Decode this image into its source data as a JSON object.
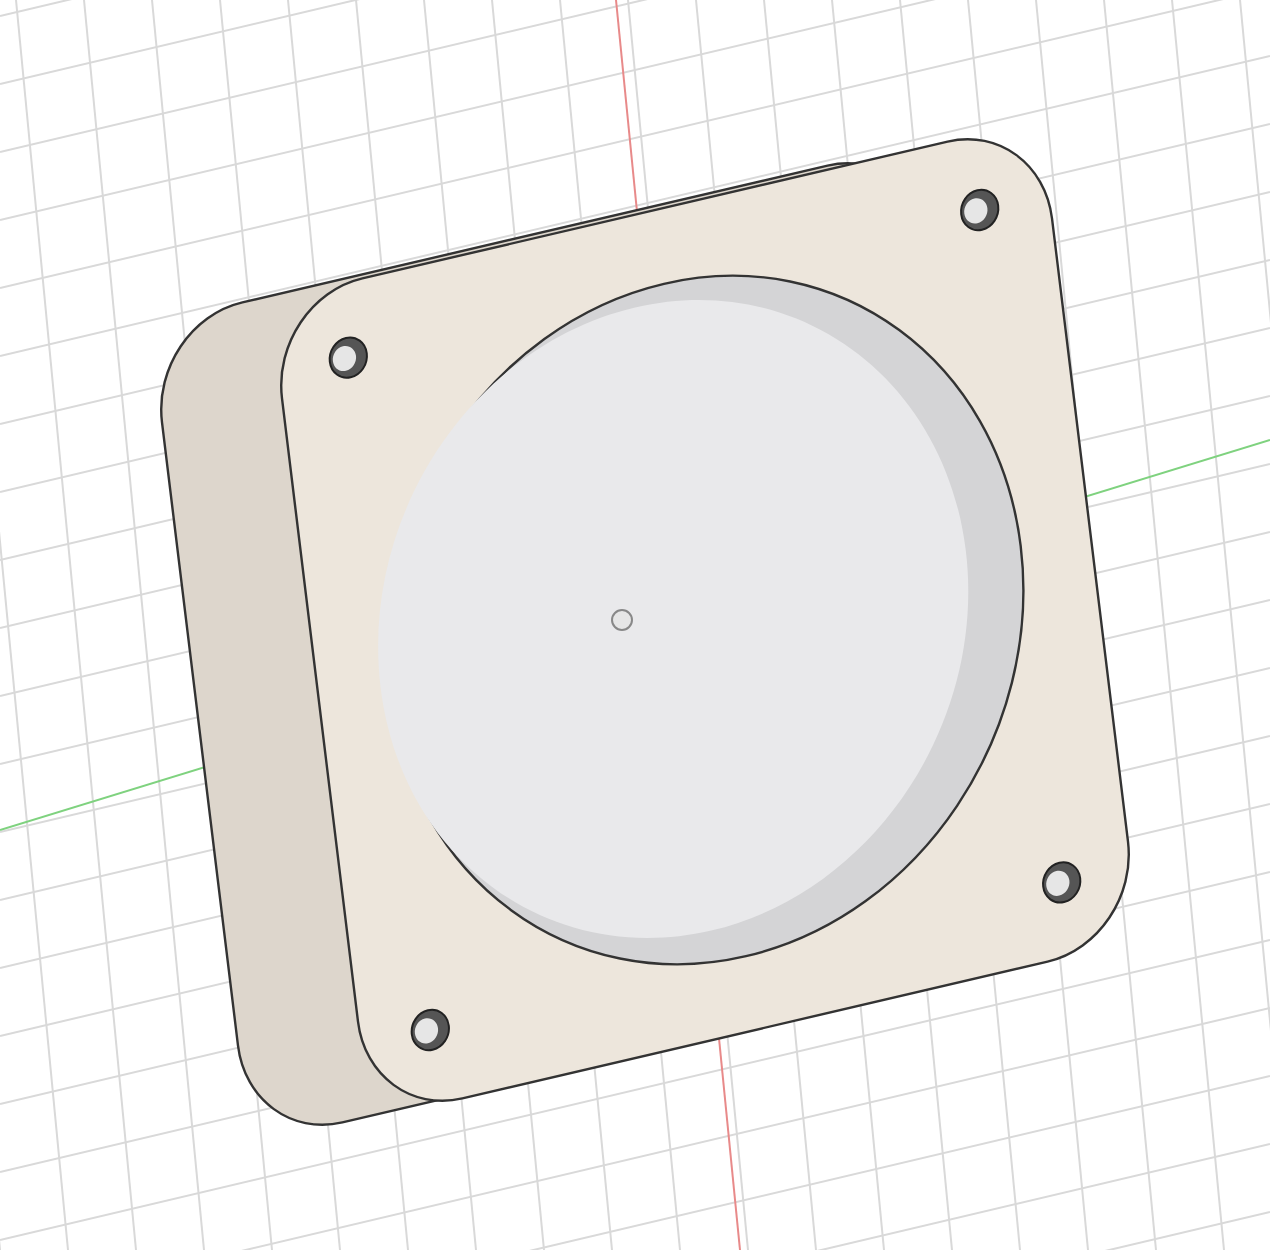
{
  "viewport": {
    "grid_visible": true,
    "axes_visible": true,
    "origin_visible": true
  }
}
